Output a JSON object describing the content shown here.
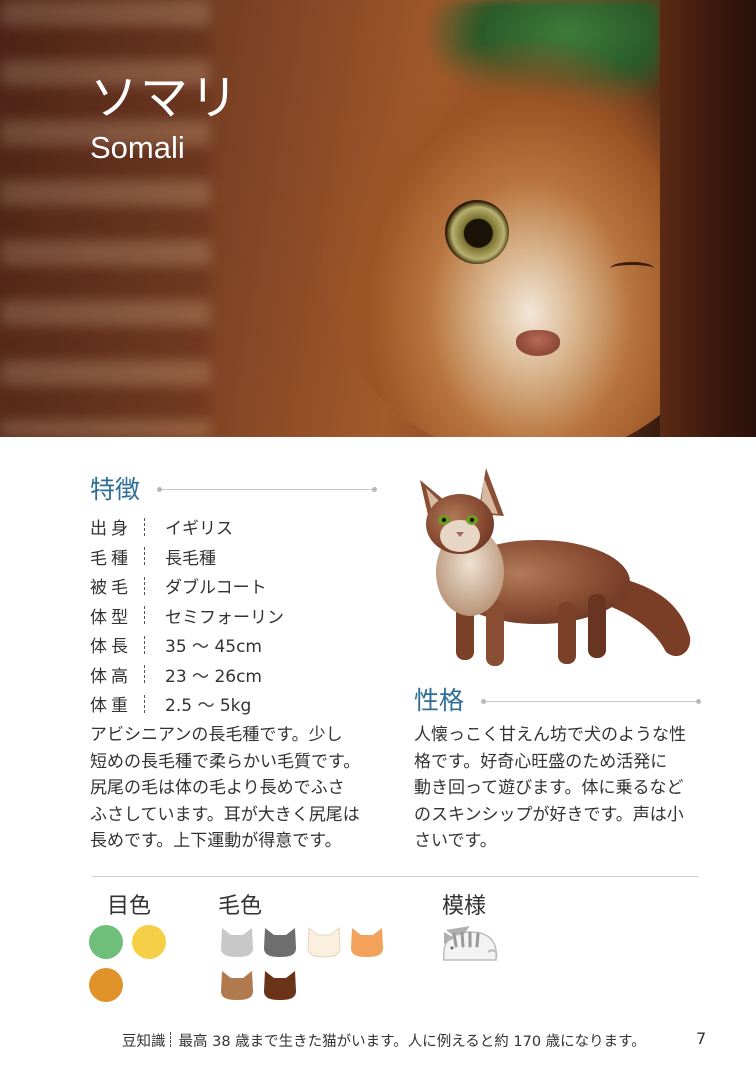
{
  "hero": {
    "title_ja": "ソマリ",
    "title_en": "Somali"
  },
  "features": {
    "heading": "特徴",
    "specs": [
      {
        "label": "出身",
        "value": "イギリス"
      },
      {
        "label": "毛種",
        "value": "長毛種"
      },
      {
        "label": "被毛",
        "value": "ダブルコート"
      },
      {
        "label": "体型",
        "value": "セミフォーリン"
      },
      {
        "label": "体長",
        "value": "35 〜 45cm"
      },
      {
        "label": "体高",
        "value": "23 〜 26cm"
      },
      {
        "label": "体重",
        "value": "2.5 〜 5kg"
      }
    ],
    "description": [
      "アビシニアンの長毛種です。少し",
      "短めの長毛種で柔らかい毛質です。",
      "尻尾の毛は体の毛より長めでふさ",
      "ふさしています。耳が大きく尻尾は",
      "長めです。上下運動が得意です。"
    ]
  },
  "personality": {
    "heading": "性格",
    "description": [
      "人懐っこく甘えん坊で犬のような性",
      "格です。好奇心旺盛のため活発に",
      "動き回って遊びます。体に乗るなど",
      "のスキンシップが好きです。声は小",
      "さいです。"
    ]
  },
  "colors": {
    "eye_label": "目色",
    "eye_colors": [
      "#6fbf7a",
      "#f5cf45",
      "#e0932a"
    ],
    "coat_label": "毛色",
    "coat_colors": [
      "#c8c8c8",
      "#6e6e6e",
      "#fbf0df",
      "#f2a25a",
      "#b07a4e",
      "#6b3418"
    ],
    "pattern_label": "模様",
    "pattern_icon": "tabby-cat-icon"
  },
  "footer": {
    "label": "豆知識",
    "text": "最高 38 歳まで生きた猫がいます。人に例えると約 170 歳になります。",
    "page_number": "7"
  }
}
